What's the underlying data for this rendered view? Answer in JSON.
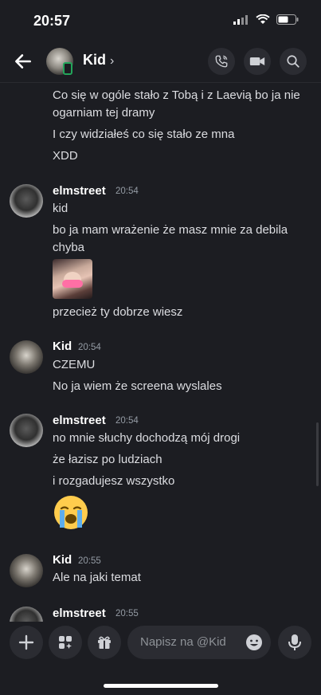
{
  "status": {
    "time": "20:57"
  },
  "header": {
    "title": "Kid",
    "chevron": "›"
  },
  "messages": {
    "top_lines": [
      "Co się w ogóle stało z Tobą i z Laevią bo ja nie",
      "ogarniam tej dramy",
      "I czy widziałeś co się stało ze mna",
      "XDD"
    ],
    "groups": [
      {
        "author": "elmstreet",
        "time": "20:54",
        "lines": [
          "kid",
          "bo ja mam wrażenie że masz mnie za debila",
          "chyba",
          "przecież ty dobrze wiesz"
        ]
      },
      {
        "author": "Kid",
        "time": "20:54",
        "lines": [
          "CZEMU",
          "No ja wiem że screena wyslales"
        ]
      },
      {
        "author": "elmstreet",
        "time": "20:54",
        "lines": [
          "no mnie słuchy dochodzą mój drogi",
          "że łazisz po ludziach",
          "i rozgadujesz wszystko"
        ]
      },
      {
        "author": "Kid",
        "time": "20:55",
        "lines": [
          "Ale na jaki temat"
        ]
      },
      {
        "author": "elmstreet",
        "time": "20:55",
        "lines": []
      }
    ]
  },
  "composer": {
    "placeholder": "Napisz na @Kid"
  },
  "icons": {
    "back": "arrow-left-icon",
    "call": "phone-icon",
    "video": "video-camera-icon",
    "search": "search-icon",
    "plus": "plus-icon",
    "apps": "apps-icon",
    "gift": "gift-icon",
    "emoji": "emoji-icon",
    "mic": "microphone-icon"
  },
  "colors": {
    "background": "#1c1d22",
    "button": "#2b2c32",
    "online": "#23a55a"
  }
}
